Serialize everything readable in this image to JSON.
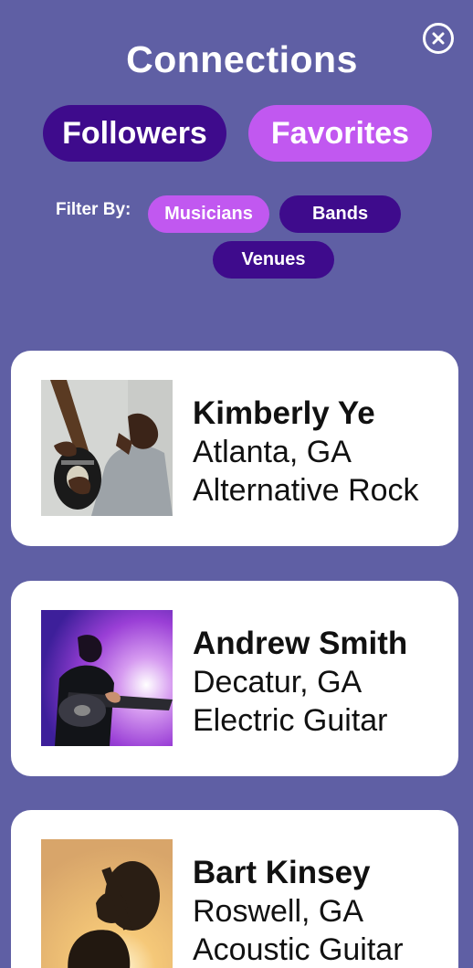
{
  "header": {
    "title": "Connections",
    "close_icon": "close-circle-icon"
  },
  "tabs": [
    {
      "label": "Followers",
      "active": false
    },
    {
      "label": "Favorites",
      "active": true
    }
  ],
  "filter": {
    "label": "Filter By:",
    "options": [
      {
        "label": "Musicians",
        "active": true
      },
      {
        "label": "Bands",
        "active": false
      },
      {
        "label": "Venues",
        "active": false
      }
    ]
  },
  "connections": [
    {
      "name": "Kimberly Ye",
      "location": "Atlanta, GA",
      "genre": "Alternative Rock"
    },
    {
      "name": "Andrew Smith",
      "location": "Decatur, GA",
      "genre": "Electric Guitar"
    },
    {
      "name": "Bart Kinsey",
      "location": "Roswell, GA",
      "genre": "Acoustic Guitar"
    }
  ],
  "colors": {
    "background": "#5f5fa4",
    "active_pill": "#c158f0",
    "inactive_pill": "#3e0b8c",
    "card": "#ffffff"
  }
}
